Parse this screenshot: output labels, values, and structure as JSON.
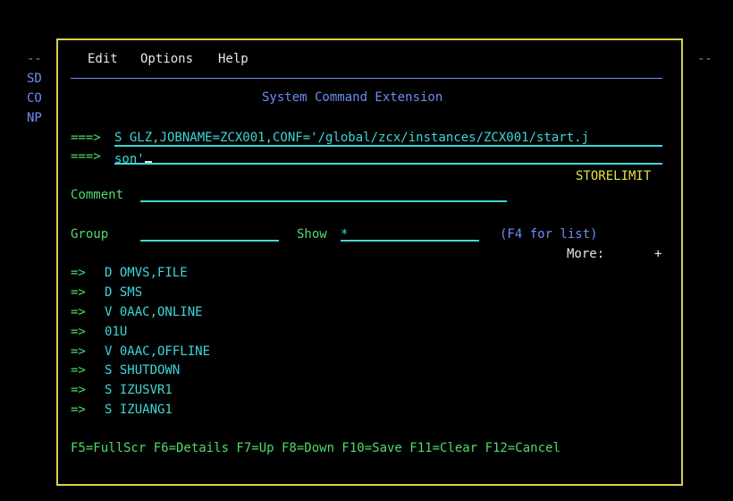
{
  "background_screen": {
    "left_dashes": "--",
    "right_dashes": "--",
    "left_labels": [
      "SD",
      "CO",
      "NP"
    ]
  },
  "menu": {
    "items": [
      "Edit",
      "Options",
      "Help"
    ]
  },
  "title": "System Command Extension",
  "command": {
    "prompt": "===>",
    "line1": "S GLZ,JOBNAME=ZCX001,CONF='/global/zcx/instances/ZCX001/start.j",
    "line2": "son'"
  },
  "storelimit": "STORELIMIT",
  "comment": {
    "label": "Comment",
    "value": ""
  },
  "group": {
    "label": "Group",
    "value": ""
  },
  "show": {
    "label": "Show",
    "value": "*"
  },
  "f4_hint": "(F4 for list)",
  "more": {
    "label": "More:",
    "indicator": "+"
  },
  "history": {
    "arrow": "=>",
    "commands": [
      "D OMVS,FILE",
      "D SMS",
      "V 0AAC,ONLINE",
      "01U",
      "V 0AAC,OFFLINE",
      "S SHUTDOWN",
      "S IZUSVR1",
      "S IZUANG1"
    ]
  },
  "function_keys": "F5=FullScr F6=Details F7=Up F8=Down F10=Save F11=Clear F12=Cancel",
  "colors": {
    "frame": "#d8d24a",
    "blue": "#6f8cf5",
    "green": "#4fdc6a",
    "turquoise": "#3fd6d6",
    "yellow": "#e6e43c",
    "white": "#e8e8e8"
  }
}
